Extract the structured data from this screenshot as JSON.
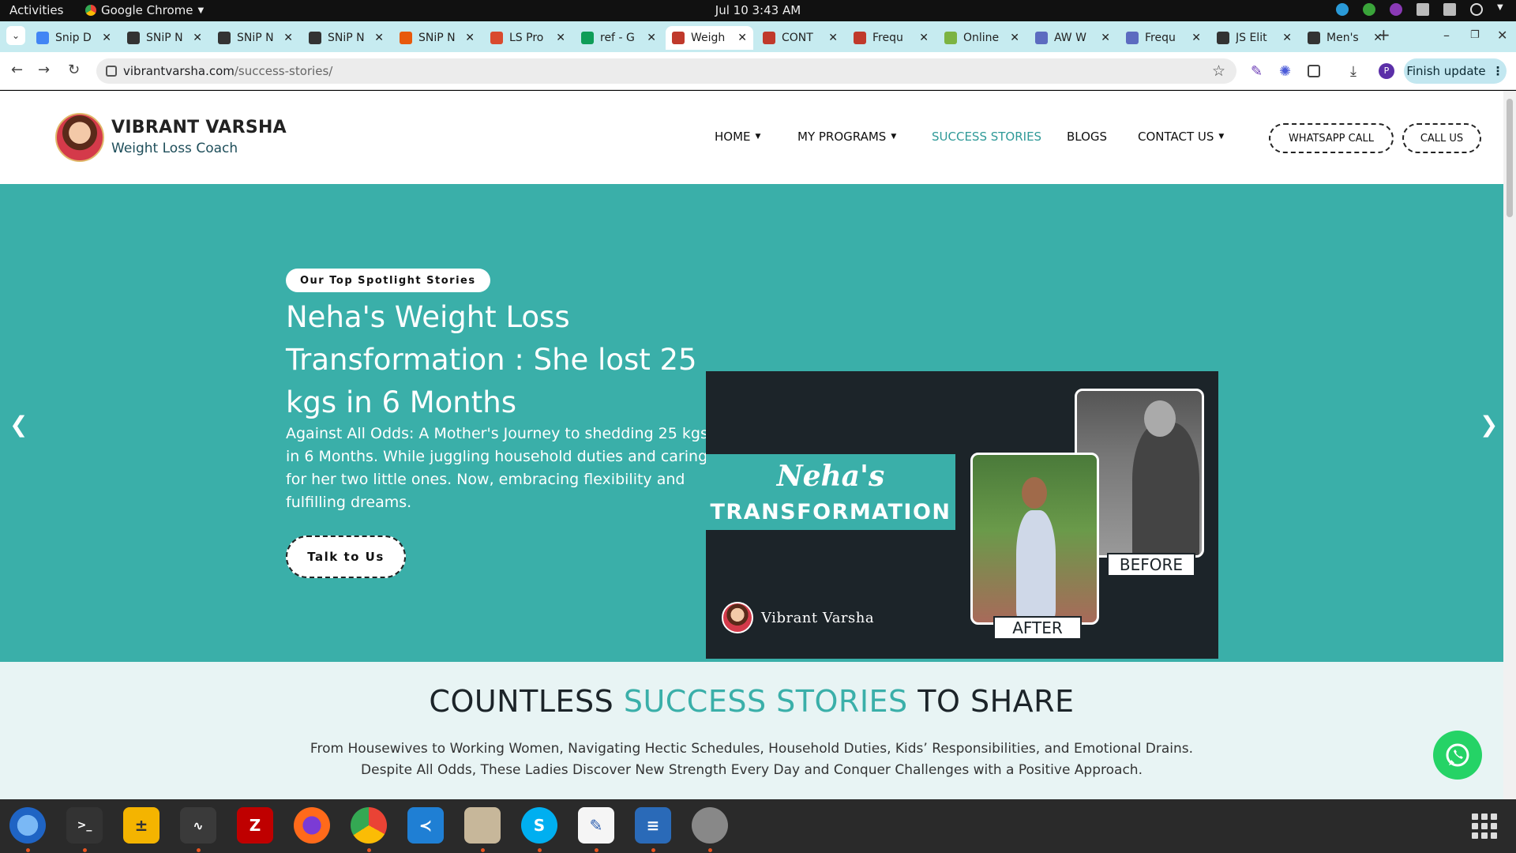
{
  "os": {
    "activities": "Activities",
    "app_name": "Google Chrome",
    "clock": "Jul 10  3:43 AM"
  },
  "browser": {
    "tabs": [
      {
        "title": "Snip D",
        "icon": "docs-icon",
        "color": "#4285f4"
      },
      {
        "title": "SNiP N",
        "icon": "snip-icon",
        "color": "#333333"
      },
      {
        "title": "SNiP N",
        "icon": "snip-icon",
        "color": "#333333"
      },
      {
        "title": "SNiP N",
        "icon": "snip-icon",
        "color": "#333333"
      },
      {
        "title": "SNiP N",
        "icon": "flame-icon",
        "color": "#e8590c"
      },
      {
        "title": "LS Pro",
        "icon": "ls-icon",
        "color": "#d94a2e"
      },
      {
        "title": "ref - G",
        "icon": "sheets-icon",
        "color": "#0f9d58"
      },
      {
        "title": "Weigh",
        "icon": "avatar-icon",
        "color": "#c0392b"
      },
      {
        "title": "CONT",
        "icon": "avatar-icon",
        "color": "#c0392b"
      },
      {
        "title": "Frequ",
        "icon": "avatar-icon",
        "color": "#c0392b"
      },
      {
        "title": "Online",
        "icon": "image-icon",
        "color": "#7cb342"
      },
      {
        "title": "AW W",
        "icon": "image-icon",
        "color": "#5c6bc0"
      },
      {
        "title": "Frequ",
        "icon": "image-icon",
        "color": "#5c6bc0"
      },
      {
        "title": "JS Elit",
        "icon": "shield-icon",
        "color": "#333333"
      },
      {
        "title": "Men's",
        "icon": "shield-icon",
        "color": "#333333"
      }
    ],
    "active_tab": 7,
    "url_domain": "vibrantvarsha.com",
    "url_path": "/success-stories/",
    "finish_update": "Finish update",
    "profile_initial": "P"
  },
  "site": {
    "brand_name": "VIBRANT VARSHA",
    "brand_sub": "Weight Loss Coach",
    "menu": {
      "home": "HOME",
      "programs": "MY PROGRAMS",
      "stories": "SUCCESS STORIES",
      "blogs": "BLOGS",
      "contact": "CONTACT US"
    },
    "whatsapp_call": "WHATSAPP CALL",
    "call_us": "CALL US"
  },
  "hero": {
    "pill": "Our Top Spotlight Stories",
    "title": "Neha's Weight Loss Transformation : She lost 25 kgs in 6 Months",
    "text": "Against All Odds: A Mother's Journey to shedding 25 kgs in 6 Months. While juggling household duties and caring for her two little ones. Now, embracing flexibility and fulfilling dreams.",
    "button": "Talk to Us",
    "image": {
      "name_script": "Neha's",
      "headline": "TRANSFORMATION",
      "before": "BEFORE",
      "after": "AFTER",
      "brand": "Vibrant Varsha"
    },
    "slide_count": 5,
    "active_slide": 1
  },
  "section": {
    "title_a": "COUNTLESS",
    "title_b": "SUCCESS STORIES",
    "title_c": "TO SHARE",
    "sub1": "From Housewives to Working Women, Navigating Hectic Schedules, Household Duties, Kids’ Responsibilities, and Emotional Drains.",
    "sub2": "Despite All Odds, These Ladies Discover New Strength Every Day and Conquer Challenges with a Positive Approach."
  },
  "colors": {
    "accent": "#3aafa9",
    "dark": "#1c2429",
    "whatsapp": "#25d366"
  }
}
